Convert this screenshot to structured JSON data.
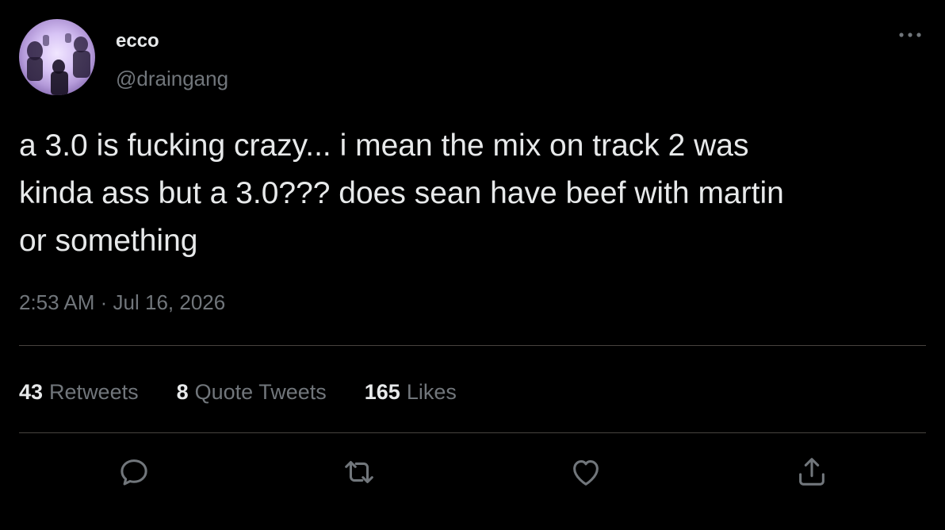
{
  "author": {
    "display_name": "ecco",
    "handle": "@draingang",
    "avatar_icon": "avatar-photo"
  },
  "tweet": {
    "text": "a 3.0 is fucking crazy... i mean the mix on track 2 was\nkinda ass but a 3.0??? does sean have beef with martin\nor something",
    "time": "2:53 AM",
    "separator": "·",
    "date": "Jul 16, 2026"
  },
  "stats": {
    "retweets_count": "43",
    "retweets_label": "Retweets",
    "quote_count": "8",
    "quote_label": "Quote Tweets",
    "likes_count": "165",
    "likes_label": "Likes"
  },
  "actions": {
    "reply_icon": "reply-icon",
    "retweet_icon": "retweet-icon",
    "like_icon": "heart-icon",
    "share_icon": "share-icon",
    "more_icon": "more-icon"
  },
  "colors": {
    "background": "#000000",
    "primary_text": "#e7e9ea",
    "secondary_text": "#71767b",
    "divider": "#47433f"
  }
}
